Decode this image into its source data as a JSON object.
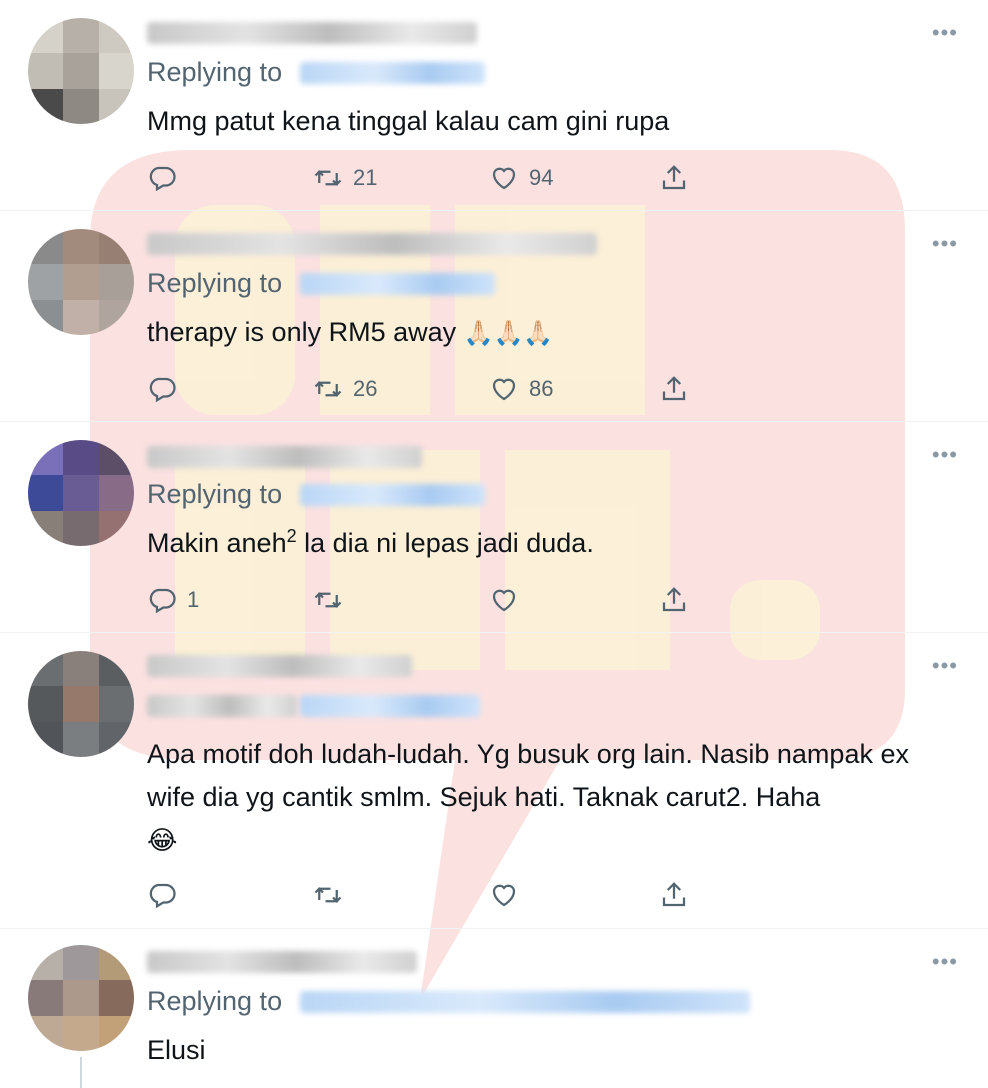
{
  "tweets": [
    {
      "replying_label": "Replying to",
      "text": "Mmg patut kena tinggal kalau cam gini rupa",
      "replies": "",
      "retweets": "21",
      "likes": "94",
      "avatar_colors": [
        "#d6d2c8",
        "#b7b0a6",
        "#cfcabf",
        "#c2bdb3",
        "#a9a298",
        "#d9d5cc",
        "#4a4a4a",
        "#8f8a82",
        "#c9c4bb"
      ]
    },
    {
      "replying_label": "Replying to",
      "text": "therapy is only RM5 away",
      "emoji": "🙏🏻🙏🏻🙏🏻",
      "replies": "",
      "retweets": "26",
      "likes": "86",
      "avatar_colors": [
        "#8a8a8a",
        "#a58a7a",
        "#9a7f70",
        "#9da2a4",
        "#b59c8e",
        "#a99f98",
        "#8c8f91",
        "#c2b0a5",
        "#b0a59c"
      ]
    },
    {
      "replying_label": "Replying to",
      "text_pre": "Makin aneh",
      "text_sup": "2",
      "text_post": " la dia ni lepas jadi duda.",
      "replies": "1",
      "retweets": "",
      "likes": "",
      "avatar_colors": [
        "#7a6fc4",
        "#5a4a8f",
        "#5c4d6a",
        "#3a49a5",
        "#6a5a9c",
        "#8a6a8a",
        "#8a7f78",
        "#7a6a70",
        "#9a7070"
      ]
    },
    {
      "replying_label": "",
      "text": "Apa motif doh ludah-ludah. Yg busuk org lain. Nasib nampak ex wife dia yg cantik smlm. Sejuk hati. Taknak carut2. Haha",
      "emoji": "😂",
      "replies": "",
      "retweets": "",
      "likes": "",
      "avatar_colors": [
        "#6a6e72",
        "#8a7f7a",
        "#5a5e62",
        "#55595d",
        "#9a7868",
        "#6a6e70",
        "#50555a",
        "#7a7e82",
        "#60656a"
      ]
    },
    {
      "replying_label": "Replying to",
      "text": "Elusi",
      "avatar_colors": [
        "#b8b0a8",
        "#a0989a",
        "#b89a70",
        "#8a7a78",
        "#b09888",
        "#8a6a58",
        "#c0a890",
        "#c8a888",
        "#c8a070"
      ]
    }
  ],
  "more_icon": "more-dots-icon",
  "icons": [
    "reply-icon",
    "retweet-icon",
    "like-icon",
    "share-icon"
  ],
  "colors": {
    "secondary_text": "#536471",
    "divider": "#eff3f4",
    "watermark_red": "#f4c6c3",
    "watermark_cream": "#fdf4d8"
  }
}
